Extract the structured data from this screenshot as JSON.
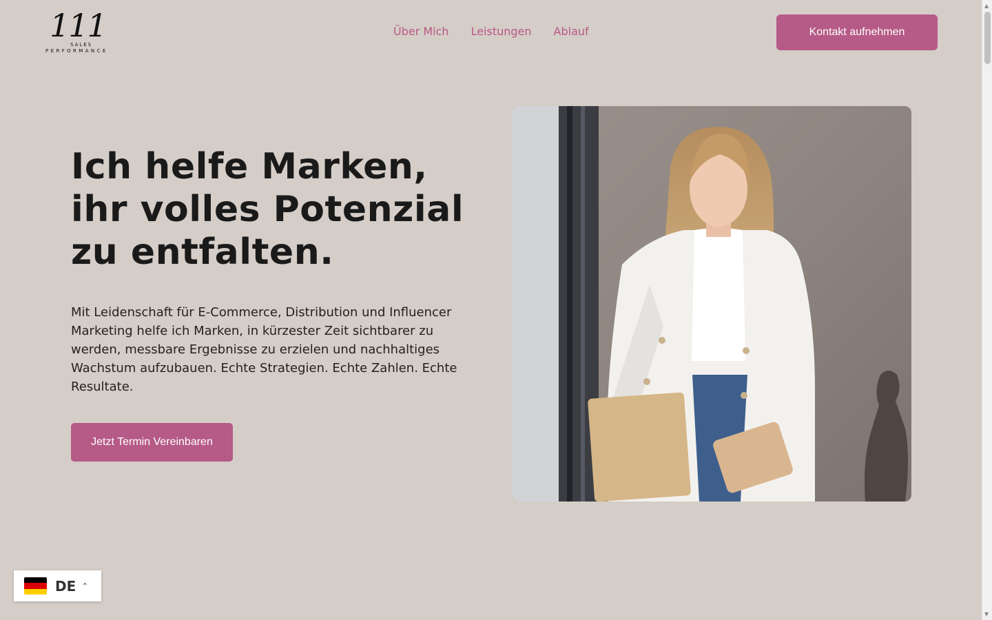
{
  "brand": {
    "logo_number": "111",
    "logo_line1": "SALES",
    "logo_line2": "PERFORMANCE"
  },
  "nav": {
    "items": [
      {
        "label": "Über Mich"
      },
      {
        "label": "Leistungen"
      },
      {
        "label": "Ablauf"
      }
    ],
    "contact_button": "Kontakt aufnehmen"
  },
  "hero": {
    "title": "Ich helfe Marken, ihr volles Potenzial zu entfalten.",
    "text": "Mit Leidenschaft für E-Commerce, Distribution und Influencer Marketing helfe ich Marken, in kürzester Zeit sichtbarer zu werden, messbare Ergebnisse zu erzielen und nachhaltiges Wachstum aufzubauen. Echte Strategien. Echte Zahlen. Echte Resultate.",
    "cta_button": "Jetzt Termin Vereinbaren"
  },
  "language": {
    "code": "DE",
    "flag_icon": "germany-flag-icon",
    "chevron_icon": "chevron-up-icon"
  },
  "colors": {
    "background": "#d5cdc7",
    "accent": "#b65a87",
    "nav_link": "#b85987"
  }
}
